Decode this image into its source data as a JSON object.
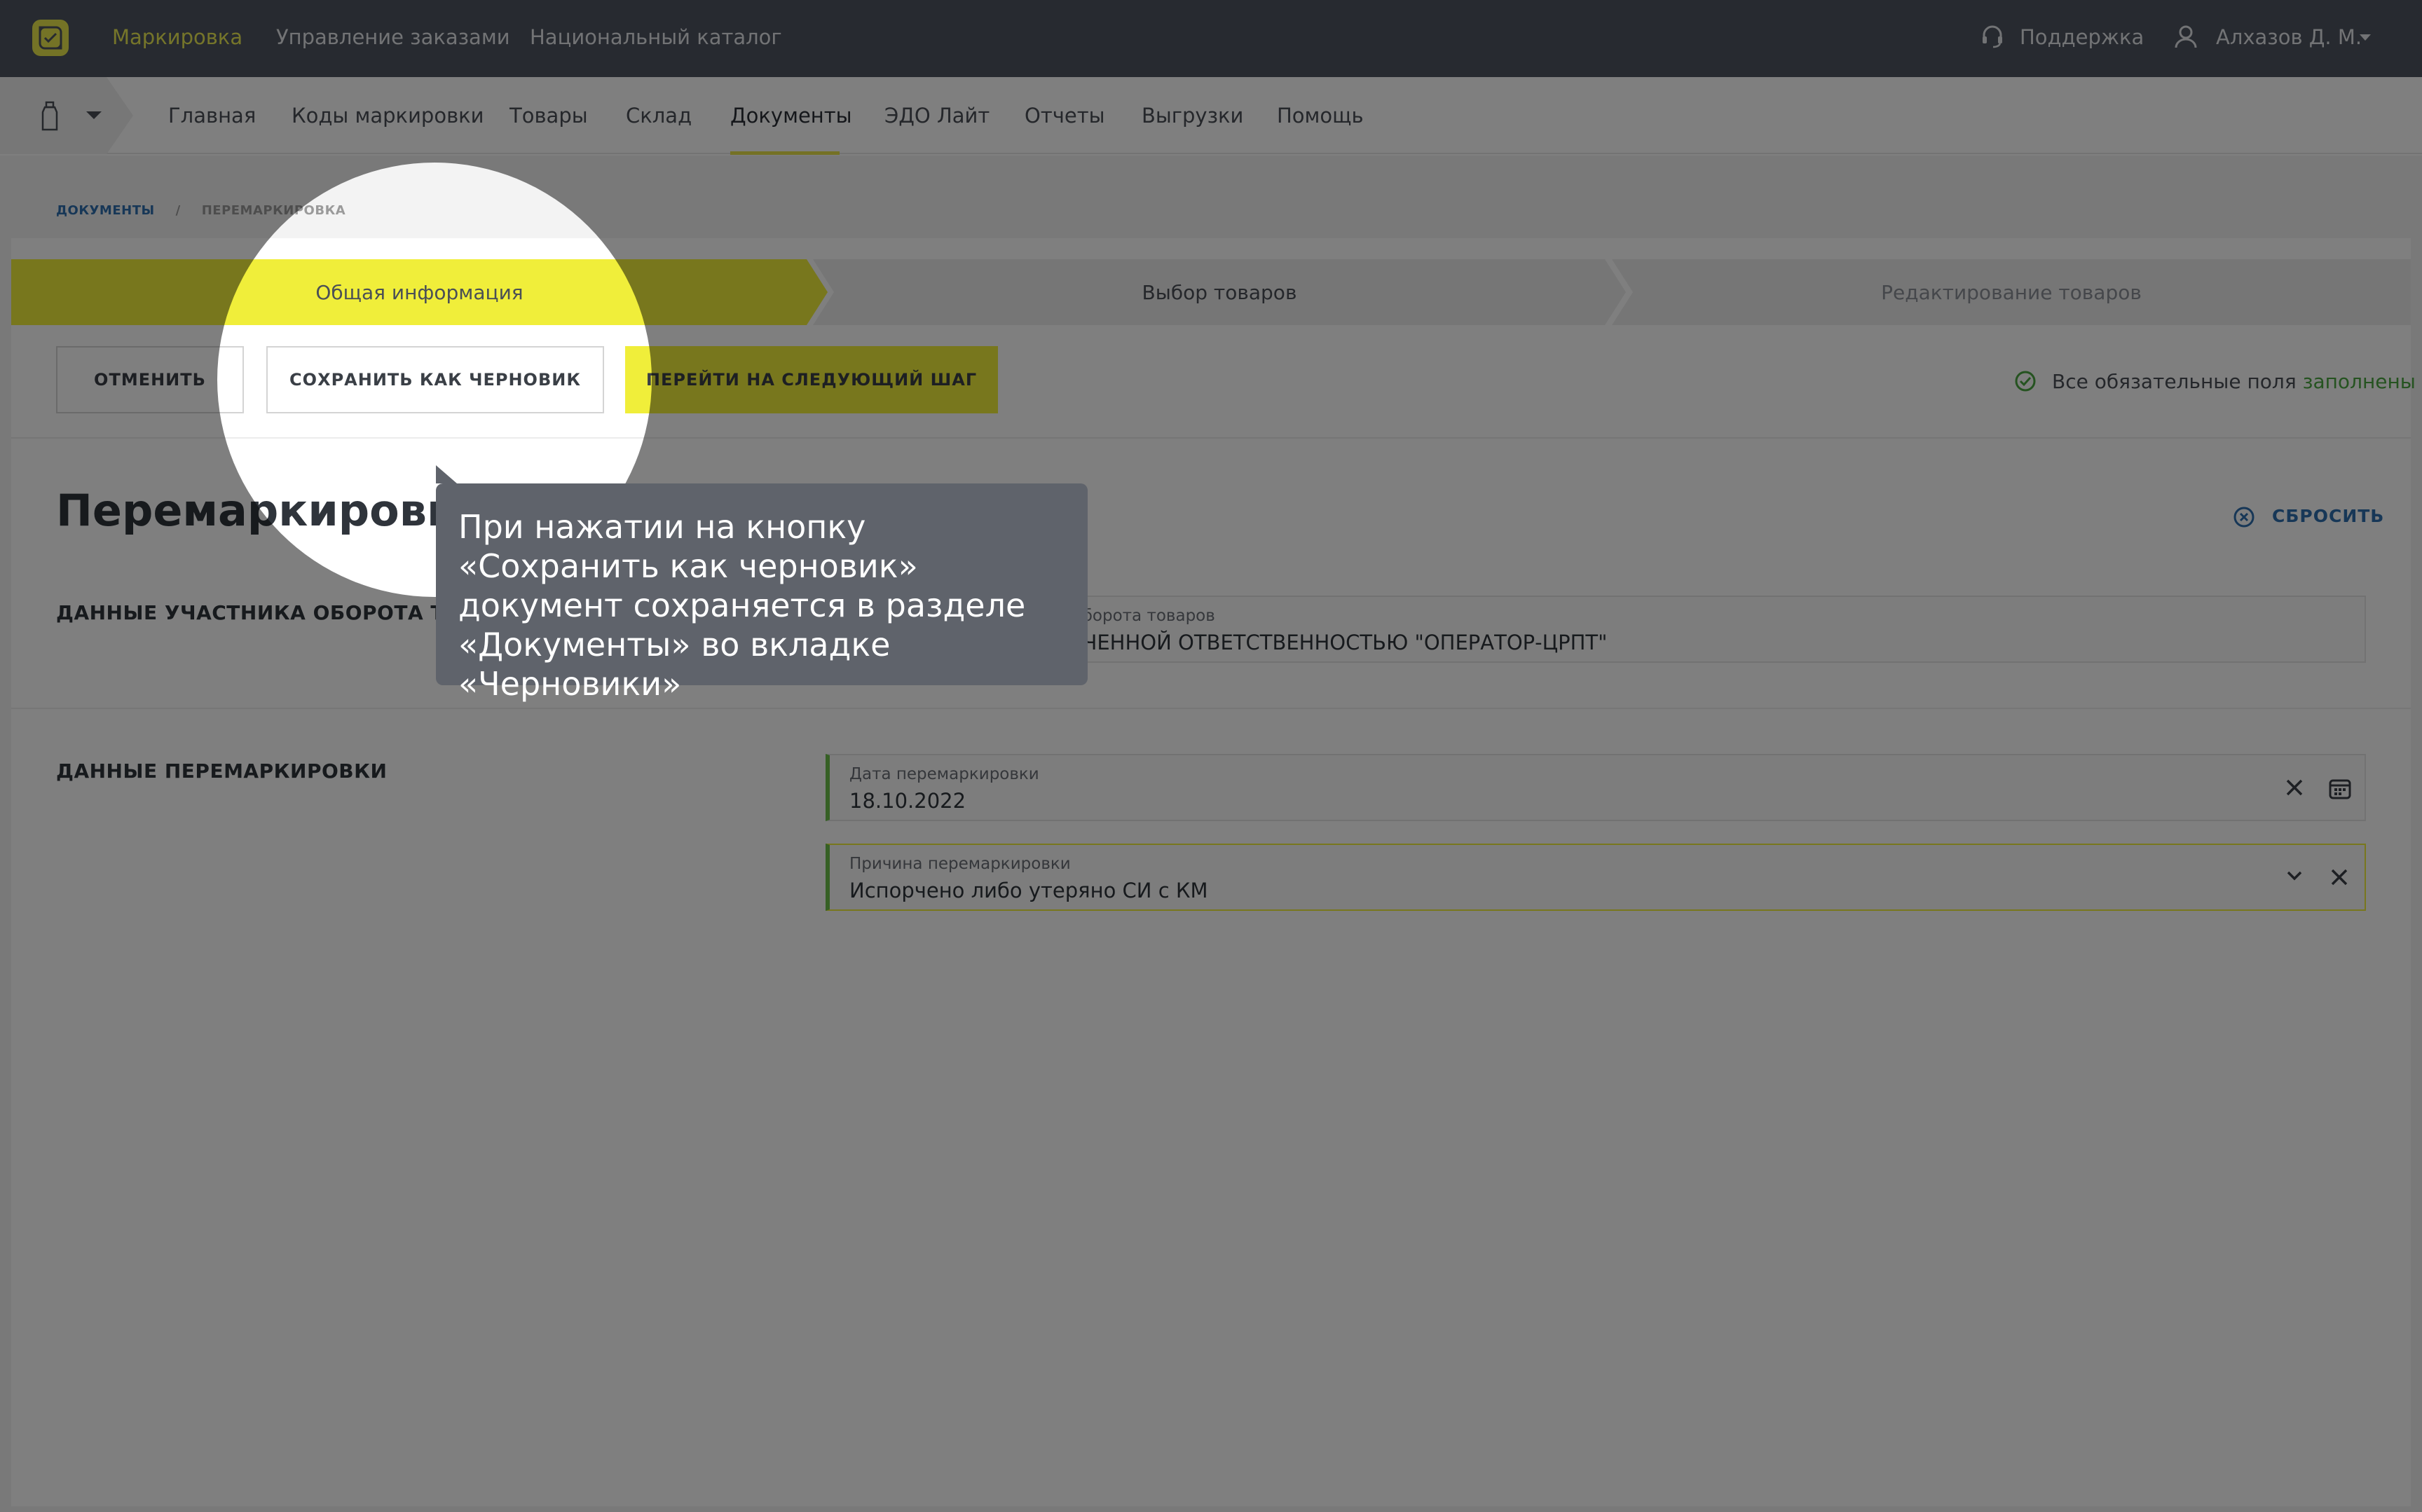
{
  "topbar": {
    "nav": [
      "Маркировка",
      "Управление заказами",
      "Национальный каталог"
    ],
    "support": "Поддержка",
    "user": "Алхазов Д. М."
  },
  "subnav": {
    "items": [
      "Главная",
      "Коды маркировки",
      "Товары",
      "Склад",
      "Документы",
      "ЭДО Лайт",
      "Отчеты",
      "Выгрузки",
      "Помощь"
    ],
    "active": "Документы"
  },
  "breadcrumb": {
    "link": "ДОКУМЕНТЫ",
    "separator": "/",
    "current": "ПЕРЕМАРКИРОВКА"
  },
  "stepper": {
    "steps": [
      "Общая информация",
      "Выбор товаров",
      "Редактирование товаров"
    ]
  },
  "actions": {
    "cancel": "ОТМЕНИТЬ",
    "save_draft": "СОХРАНИТЬ КАК ЧЕРНОВИК",
    "next": "ПЕРЕЙТИ НА СЛЕДУЮЩИЙ ШАГ"
  },
  "status": {
    "text": "Все обязательные поля ",
    "highlight": "заполнены"
  },
  "document": {
    "title": "Перемаркировка",
    "reset": "СБРОСИТЬ"
  },
  "participant": {
    "section": "ДАННЫЕ УЧАСТНИКА ОБОРОТА ТОВАРОВ",
    "field_label": "Наименование участника оборота товаров",
    "field_value": "ОБЩЕСТВО С ОГРАНИЧЕННОЙ ОТВЕТСТВЕННОСТЬЮ \"ОПЕРАТОР-ЦРПТ\""
  },
  "remarking": {
    "section": "ДАННЫЕ ПЕРЕМАРКИРОВКИ",
    "date_label": "Дата перемаркировки",
    "date_value": "18.10.2022",
    "reason_label": "Причина перемаркировки",
    "reason_value": "Испорчено либо утеряно СИ с КМ"
  },
  "tooltip": {
    "text": "При нажатии на кнопку «Сохранить как черновик» документ сохраняется в разделе «Документы» во вкладке «Черновики»"
  },
  "colors": {
    "accent": "#f0ee3a",
    "link": "#2f6fae",
    "success": "#4aa640",
    "topbar": "#4e5560",
    "overlay": "rgba(0,0,0,0.5)"
  }
}
